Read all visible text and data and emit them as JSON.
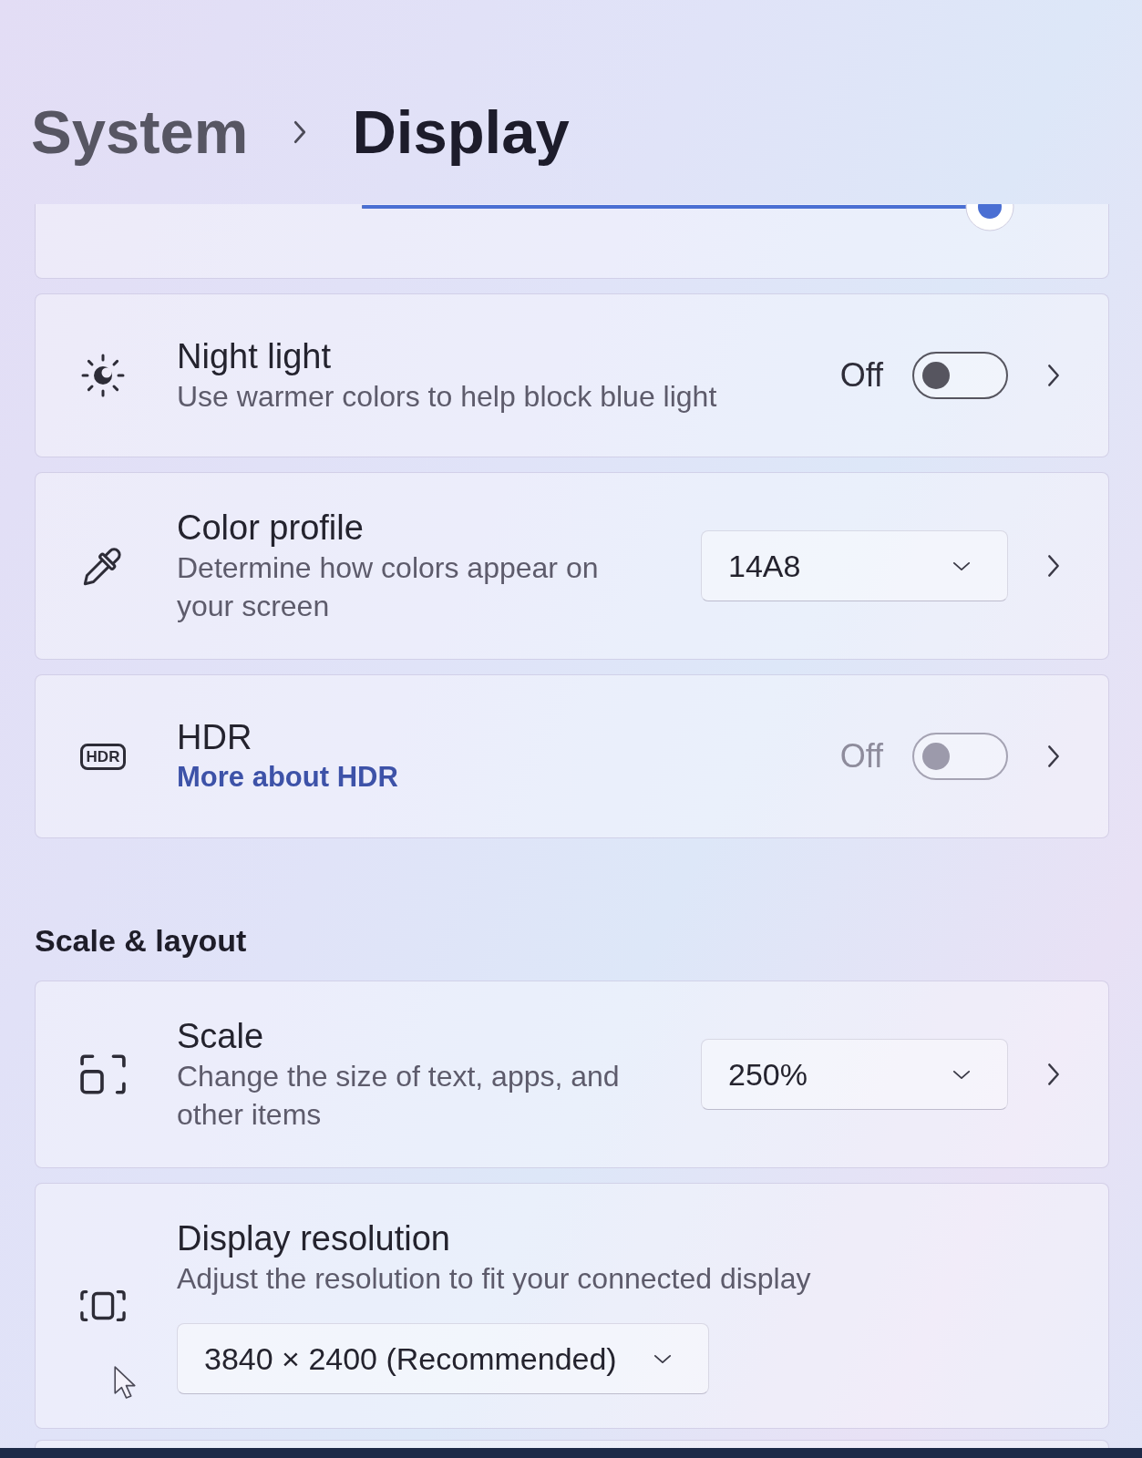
{
  "header": {
    "parent": "System",
    "current": "Display"
  },
  "brightness": {
    "slider": {
      "level": 1
    }
  },
  "settings": [
    {
      "kind": "toggle",
      "title": "Night light",
      "description": "Use warmer colors to help block blue light",
      "toggle": {
        "label": "Off",
        "on": false,
        "disabled": false
      }
    },
    {
      "kind": "dropdown",
      "title": "Color profile",
      "description": "Determine how colors appear on your screen",
      "dropdown": {
        "value": "14A8"
      }
    },
    {
      "kind": "toggle",
      "title": "HDR",
      "icon_text": "HDR",
      "link": "More about HDR",
      "toggle": {
        "label": "Off",
        "on": false,
        "disabled": true
      }
    }
  ],
  "scale_layout": {
    "heading": "Scale & layout",
    "settings": [
      {
        "kind": "dropdown",
        "title": "Scale",
        "description": "Change the size of text, apps, and other items",
        "dropdown": {
          "value": "250%"
        }
      },
      {
        "kind": "stacked_dropdown",
        "title": "Display resolution",
        "description": "Adjust the resolution to fit your connected display",
        "dropdown": {
          "value": "3840 × 2400 (Recommended)"
        }
      }
    ]
  }
}
